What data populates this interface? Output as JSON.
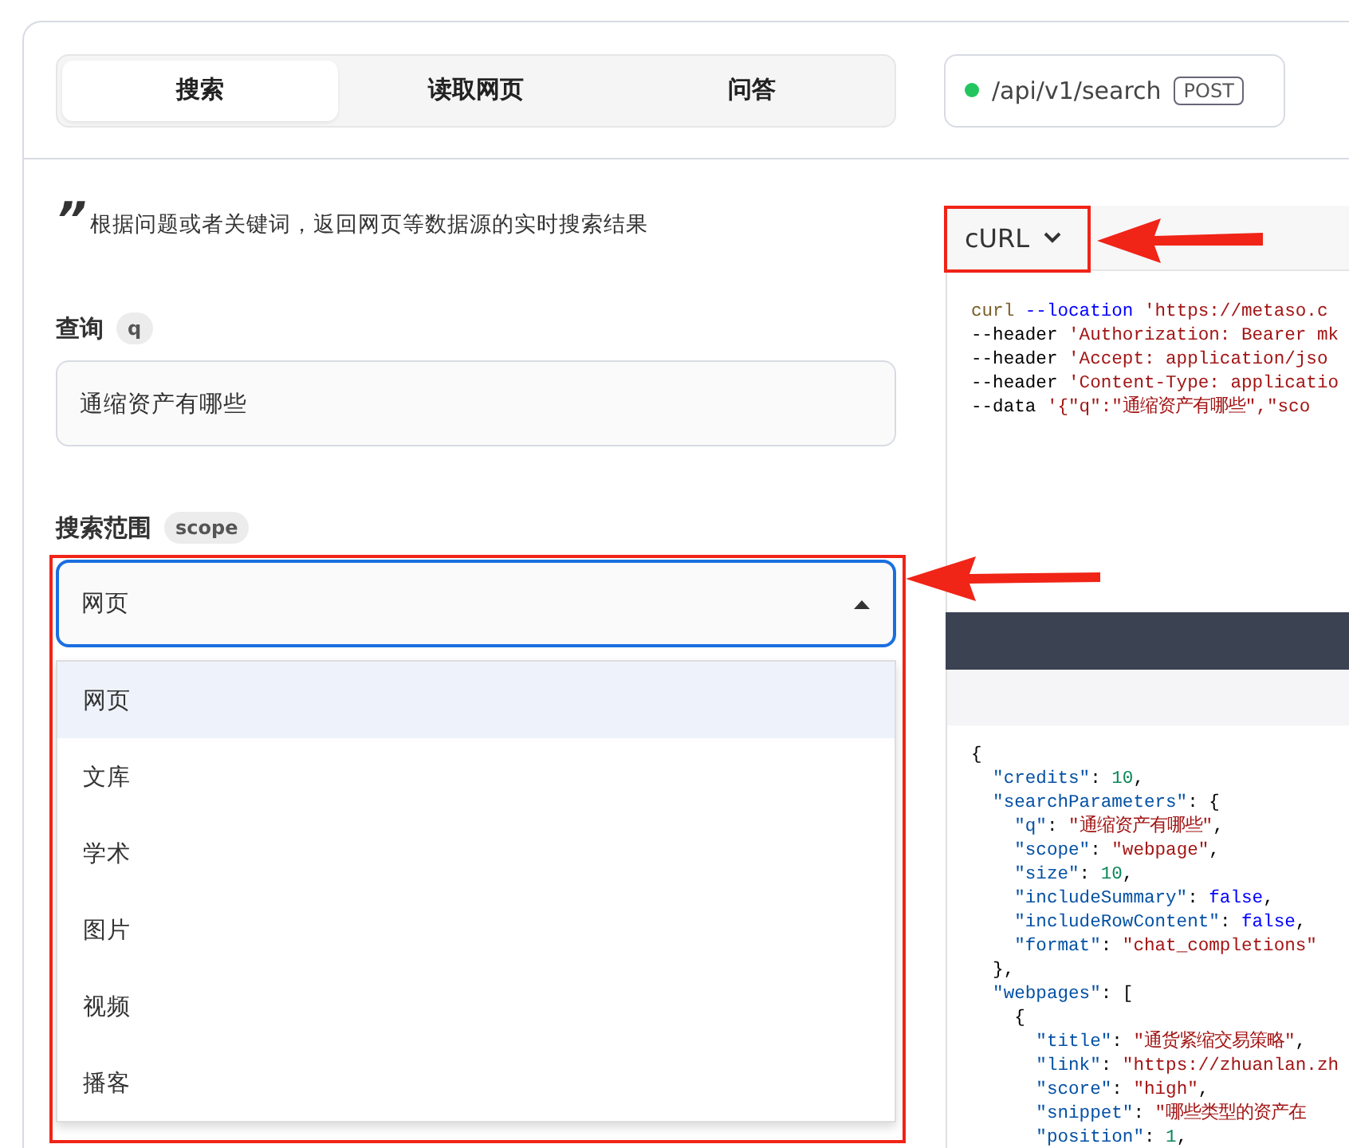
{
  "tabs": [
    {
      "label": "搜索",
      "selected": true
    },
    {
      "label": "读取网页",
      "selected": false
    },
    {
      "label": "问答",
      "selected": false
    }
  ],
  "endpoint": {
    "path": "/api/v1/search",
    "method": "POST"
  },
  "description": {
    "quote_mark": "”",
    "text": "根据问题或者关键词，返回网页等数据源的实时搜索结果"
  },
  "fields": [
    {
      "kind": "input",
      "label": "查询",
      "param": "q",
      "value": "通缩资产有哪些"
    },
    {
      "kind": "select",
      "label": "搜索范围",
      "param": "scope",
      "value": "网页",
      "expanded": true,
      "options": [
        {
          "label": "网页",
          "selected": true
        },
        {
          "label": "文库",
          "selected": false
        },
        {
          "label": "学术",
          "selected": false
        },
        {
          "label": "图片",
          "selected": false
        },
        {
          "label": "视频",
          "selected": false
        },
        {
          "label": "播客",
          "selected": false
        }
      ]
    }
  ],
  "code_panel": {
    "language": "cURL",
    "request_lines": [
      [
        {
          "kind": "command",
          "text": "curl"
        },
        {
          "kind": "option",
          "text": " --location"
        },
        {
          "kind": "string",
          "text": " 'https://metaso.c"
        }
      ],
      [
        {
          "kind": "plain",
          "text": "--header "
        },
        {
          "kind": "string",
          "text": "'Authorization: Bearer mk"
        }
      ],
      [
        {
          "kind": "plain",
          "text": "--header "
        },
        {
          "kind": "string",
          "text": "'Accept: application/jso"
        }
      ],
      [
        {
          "kind": "plain",
          "text": "--header "
        },
        {
          "kind": "string",
          "text": "'Content-Type: applicatio"
        }
      ],
      [
        {
          "kind": "plain",
          "text": "--data "
        },
        {
          "kind": "string",
          "text": "'{\"q\":\"通缩资产有哪些\",\"sco"
        }
      ]
    ],
    "response_lines": [
      [
        {
          "kind": "punct",
          "text": "{"
        }
      ],
      [
        {
          "kind": "key",
          "text": "  \"credits\""
        },
        {
          "kind": "punct",
          "text": ": "
        },
        {
          "kind": "number",
          "text": "10"
        },
        {
          "kind": "punct",
          "text": ","
        }
      ],
      [
        {
          "kind": "key",
          "text": "  \"searchParameters\""
        },
        {
          "kind": "punct",
          "text": ": {"
        }
      ],
      [
        {
          "kind": "key",
          "text": "    \"q\""
        },
        {
          "kind": "punct",
          "text": ": "
        },
        {
          "kind": "string",
          "text": "\"通缩资产有哪些\""
        },
        {
          "kind": "punct",
          "text": ","
        }
      ],
      [
        {
          "kind": "key",
          "text": "    \"scope\""
        },
        {
          "kind": "punct",
          "text": ": "
        },
        {
          "kind": "string",
          "text": "\"webpage\""
        },
        {
          "kind": "punct",
          "text": ","
        }
      ],
      [
        {
          "kind": "key",
          "text": "    \"size\""
        },
        {
          "kind": "punct",
          "text": ": "
        },
        {
          "kind": "number",
          "text": "10"
        },
        {
          "kind": "punct",
          "text": ","
        }
      ],
      [
        {
          "kind": "key",
          "text": "    \"includeSummary\""
        },
        {
          "kind": "punct",
          "text": ": "
        },
        {
          "kind": "keyword",
          "text": "false"
        },
        {
          "kind": "punct",
          "text": ","
        }
      ],
      [
        {
          "kind": "key",
          "text": "    \"includeRowContent\""
        },
        {
          "kind": "punct",
          "text": ": "
        },
        {
          "kind": "keyword",
          "text": "false"
        },
        {
          "kind": "punct",
          "text": ","
        }
      ],
      [
        {
          "kind": "key",
          "text": "    \"format\""
        },
        {
          "kind": "punct",
          "text": ": "
        },
        {
          "kind": "string",
          "text": "\"chat_completions\""
        }
      ],
      [
        {
          "kind": "punct",
          "text": "  },"
        }
      ],
      [
        {
          "kind": "key",
          "text": "  \"webpages\""
        },
        {
          "kind": "punct",
          "text": ": ["
        }
      ],
      [
        {
          "kind": "punct",
          "text": "    {"
        }
      ],
      [
        {
          "kind": "key",
          "text": "      \"title\""
        },
        {
          "kind": "punct",
          "text": ": "
        },
        {
          "kind": "string",
          "text": "\"通货紧缩交易策略\""
        },
        {
          "kind": "punct",
          "text": ","
        }
      ],
      [
        {
          "kind": "key",
          "text": "      \"link\""
        },
        {
          "kind": "punct",
          "text": ": "
        },
        {
          "kind": "string",
          "text": "\"https://zhuanlan.zh"
        }
      ],
      [
        {
          "kind": "key",
          "text": "      \"score\""
        },
        {
          "kind": "punct",
          "text": ": "
        },
        {
          "kind": "string",
          "text": "\"high\""
        },
        {
          "kind": "punct",
          "text": ","
        }
      ],
      [
        {
          "kind": "key",
          "text": "      \"snippet\""
        },
        {
          "kind": "punct",
          "text": ": "
        },
        {
          "kind": "string",
          "text": "\"哪些类型的资产在"
        }
      ],
      [
        {
          "kind": "key",
          "text": "      \"position\""
        },
        {
          "kind": "punct",
          "text": ": "
        },
        {
          "kind": "number",
          "text": "1"
        },
        {
          "kind": "punct",
          "text": ","
        }
      ]
    ]
  }
}
